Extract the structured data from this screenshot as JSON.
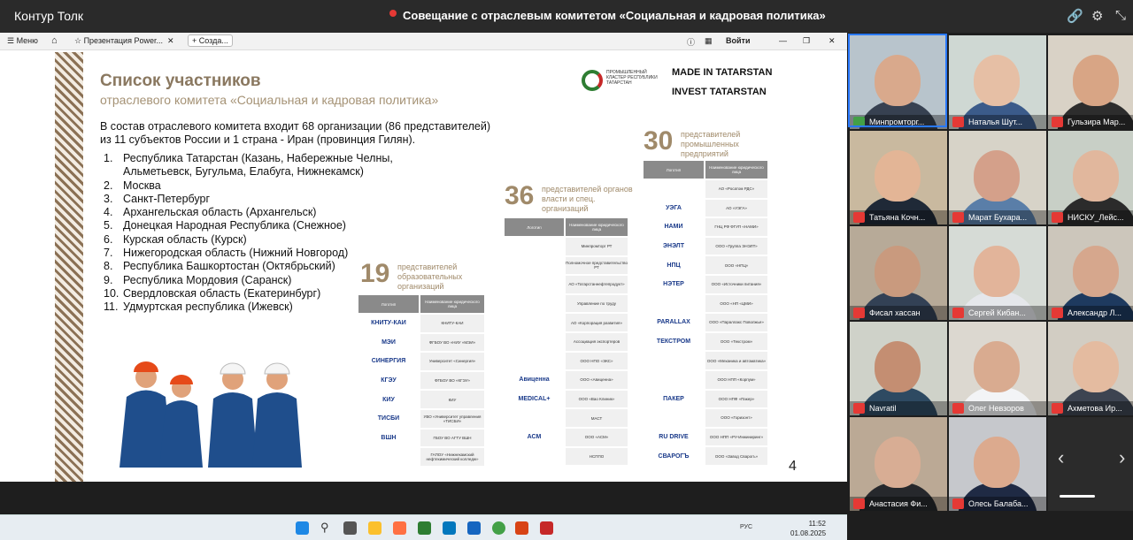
{
  "topbar": {
    "app_title": "Контур Толк",
    "meeting_title": "Совещание с отраслевым комитетом «Социальная и кадровая политика»",
    "link_icon": "link-icon",
    "settings_icon": "gear-icon",
    "fullscreen_icon": "fullscreen-icon"
  },
  "browser": {
    "menu": "Меню",
    "tab": "Презентация Power...",
    "new_tab": "+ Созда...",
    "signin": "Войти"
  },
  "slide": {
    "title": "Список участников",
    "subtitle": "отраслевого комитета «Социальная и кадровая политика»",
    "logo_cluster": "ПРОМЫШЛЕННЫЙ КЛАСТЕР РЕСПУБЛИКИ ТАТАРСТАН",
    "made_in": "MADE IN TATARSTAN",
    "invest": "INVEST TATARSTAN",
    "intro_line1": "В состав отраслевого комитета входит 68 организации (86 представителей)",
    "intro_line2": "из 11 субъектов России и 1 страна - Иран (провинция Гилян).",
    "regions": [
      {
        "n": "1.",
        "t": "Республика Татарстан (Казань, Набережные Челны,"
      },
      {
        "n": "",
        "t": "Альметьевск, Бугульма, Елабуга, Нижнекамск)"
      },
      {
        "n": "2.",
        "t": "Москва"
      },
      {
        "n": "3.",
        "t": "Санкт-Петербург"
      },
      {
        "n": "4.",
        "t": "Архангельская область (Архангельск)"
      },
      {
        "n": "5.",
        "t": "Донецкая Народная Республика (Снежное)"
      },
      {
        "n": "6.",
        "t": "Курская область (Курск)"
      },
      {
        "n": "7.",
        "t": "Нижегородская область (Нижний Новгород)"
      },
      {
        "n": "8.",
        "t": "Республика Башкортостан (Октябрьский)"
      },
      {
        "n": "9.",
        "t": "Республика Мордовия (Саранск)"
      },
      {
        "n": "10.",
        "t": "Свердловская область (Екатеринбург)"
      },
      {
        "n": "11.",
        "t": "Удмуртская республика (Ижевск)"
      }
    ],
    "col_logo": "Логотип",
    "col_name": "Наименование юридического лица",
    "group_edu": {
      "count": "19",
      "label": "представителей образовательных организаций",
      "rows": [
        [
          "КНИТУ-КАИ",
          "КНИТУ-КАИ"
        ],
        [
          "МЭИ",
          "ФГБОУ ВО «НИУ «МЭИ»"
        ],
        [
          "СИНЕРГИЯ",
          "Университет «Синергия»"
        ],
        [
          "КГЭУ",
          "ФГБОУ ВО «КГЭУ»"
        ],
        [
          "КИУ",
          "КИУ"
        ],
        [
          "ТИСБИ",
          "УВО «Университет управления «ТИСБИ»"
        ],
        [
          "ВШН",
          "ГБОУ ВО АГТУ ВШН"
        ],
        [
          "",
          "ГАПОУ «Нижнекамский нефтехимический колледж»"
        ]
      ]
    },
    "group_gov": {
      "count": "36",
      "label": "представителей органов власти и спец. организаций",
      "rows": [
        [
          "",
          "Минпромторг РТ"
        ],
        [
          "",
          "Полномочное представительство РТ"
        ],
        [
          "",
          "АО «Татарстаннефтепродукт»"
        ],
        [
          "",
          "Управление по труду"
        ],
        [
          "",
          "АО «Корпорация развития»"
        ],
        [
          "",
          "Ассоциация экспортеров"
        ],
        [
          "",
          "ООО НПО «ЭКС»"
        ],
        [
          "Авиценна",
          "ООО «Авиценна»"
        ],
        [
          "MEDICAL+",
          "ООО «Вао Клиник»"
        ],
        [
          "",
          "МАСТ"
        ],
        [
          "АСМ",
          "ООО «АСМ»"
        ],
        [
          "",
          "НСППО"
        ]
      ]
    },
    "group_ind": {
      "count": "30",
      "label": "представителей промышленных предприятий",
      "rows": [
        [
          "",
          "АО «Росатом РДС»"
        ],
        [
          "УЭГА",
          "АО «УЭГА»"
        ],
        [
          "НАМИ",
          "ГНЦ РФ ФГУП «НАМИ»"
        ],
        [
          "ЭНЭЛТ",
          "ООО «Группа ЭНЭЛТ»"
        ],
        [
          "НПЦ",
          "ООО «НПЦ»"
        ],
        [
          "НЭТЕР",
          "ООО «Источники питания»"
        ],
        [
          "",
          "ООО «НП «ЦМИ»"
        ],
        [
          "PARALLAX",
          "ООО «Параллакс Поволжье»"
        ],
        [
          "ТЕКСТРОМ",
          "ООО «Текстром»"
        ],
        [
          "",
          "ООО «Механика и автоматика»"
        ],
        [
          "",
          "ООО НПП «Корпум»"
        ],
        [
          "ПАКЕР",
          "ООО НПФ «Пакер»"
        ],
        [
          "",
          "ООО «Горизонт»"
        ],
        [
          "RU DRIVE",
          "ООО НПП «РУ-Инжиниринг»"
        ],
        [
          "СВАРОГЪ",
          "ООО «Завод Сварогъ»"
        ]
      ]
    },
    "page_number": "4"
  },
  "taskbar": {
    "time": "11:52",
    "date": "01.08.2025",
    "lang": "РУС"
  },
  "participants": [
    {
      "name": "Минпромторг...",
      "mic": "on"
    },
    {
      "name": "Наталья Шут...",
      "mic": "off"
    },
    {
      "name": "Гульзира Мар...",
      "mic": "off"
    },
    {
      "name": "Татьяна Кочн...",
      "mic": "off"
    },
    {
      "name": "Марат Бухара...",
      "mic": "off"
    },
    {
      "name": "НИСКУ_Лейс...",
      "mic": "off"
    },
    {
      "name": "Фисал хассан",
      "mic": "off"
    },
    {
      "name": "Сергей Кибан...",
      "mic": "off"
    },
    {
      "name": "Александр Л...",
      "mic": "off"
    },
    {
      "name": "Navratil",
      "mic": "off"
    },
    {
      "name": "Олег Невзоров",
      "mic": "off"
    },
    {
      "name": "Ахметова Ир...",
      "mic": "off"
    },
    {
      "name": "Анастасия Фи...",
      "mic": "off"
    },
    {
      "name": "Олесь Балаба...",
      "mic": "off"
    }
  ]
}
